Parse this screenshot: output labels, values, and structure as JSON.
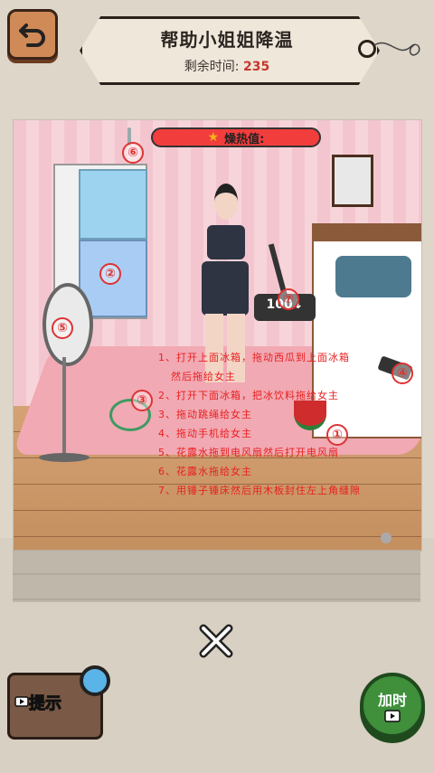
{
  "header": {
    "title": "帮助小姐姐降温",
    "timer_label": "剩余时间:",
    "timer_value": "235"
  },
  "scene": {
    "heat_label": "燥热值:",
    "plank_text": "100↓",
    "markers": [
      "①",
      "②",
      "③",
      "④",
      "⑤",
      "⑥",
      "⑦"
    ],
    "instructions": [
      "1、打开上面冰箱，拖动西瓜到上面冰箱",
      "然后拖给女主",
      "2、打开下面冰箱，把冰饮料拖给女主",
      "3、拖动跳绳给女主",
      "4、拖动手机给女主",
      "5、花露水拖到电风扇然后打开电风扇",
      "6、花露水拖给女主",
      "7、用锤子锤床然后用木板封住左上角缝隙"
    ]
  },
  "controls": {
    "hint_label": "提示",
    "speed_label": "加时"
  },
  "colors": {
    "heat_bar": "#f23d3d",
    "instruction_text": "#e82020",
    "timer_value": "#c7362d",
    "speed_button": "#3f8f3b"
  },
  "icons": [
    "back-arrow-icon",
    "close-icon",
    "video-icon",
    "magnifier-icon",
    "thumb-icon"
  ]
}
